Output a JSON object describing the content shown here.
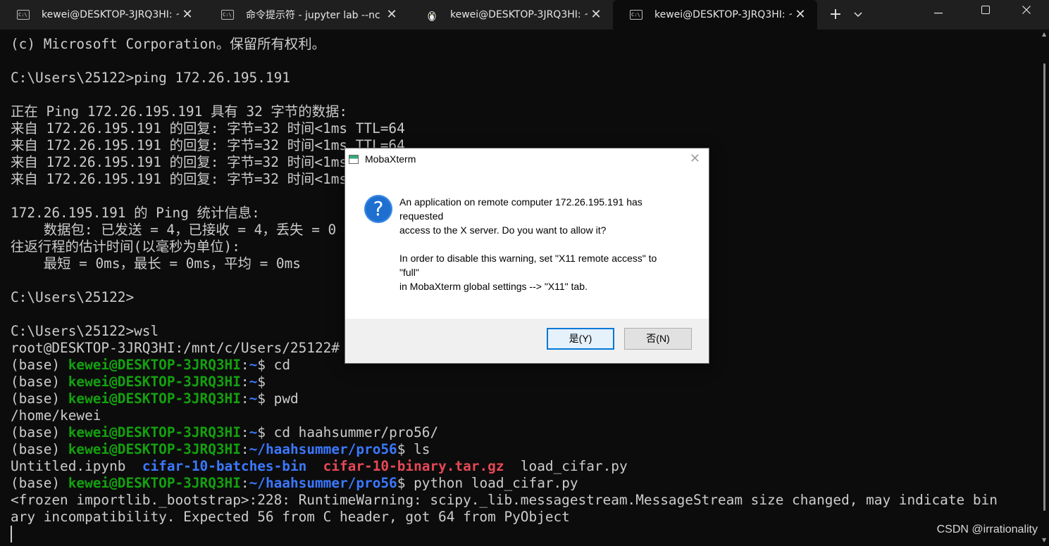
{
  "window": {
    "tabs": [
      {
        "label": "kewei@DESKTOP-3JRQ3HI: ~",
        "icon": "cmd-icon",
        "active": false
      },
      {
        "label": "命令提示符 - jupyter  lab --nc",
        "icon": "cmd-icon",
        "active": false
      },
      {
        "label": "kewei@DESKTOP-3JRQ3HI: ~",
        "icon": "tux-icon",
        "active": false
      },
      {
        "label": "kewei@DESKTOP-3JRQ3HI: ~",
        "icon": "cmd-icon",
        "active": true
      }
    ],
    "new_tab": "+",
    "dropdown": "⌄",
    "controls": {
      "minimize": "—",
      "maximize": "☐",
      "close": "✕"
    }
  },
  "terminal": {
    "lines": [
      "(c) Microsoft Corporation。保留所有权利。",
      "",
      "C:\\Users\\25122>ping 172.26.195.191",
      "",
      "正在 Ping 172.26.195.191 具有 32 字节的数据:",
      "来自 172.26.195.191 的回复: 字节=32 时间<1ms TTL=64",
      "来自 172.26.195.191 的回复: 字节=32 时间<1ms TTL=64",
      "来自 172.26.195.191 的回复: 字节=32 时间<1ms TTL=64",
      "来自 172.26.195.191 的回复: 字节=32 时间<1ms TTL=64",
      "",
      "172.26.195.191 的 Ping 统计信息:",
      "    数据包: 已发送 = 4，已接收 = 4，丢失 = 0 (0% 丢失)，",
      "往返行程的估计时间(以毫秒为单位):",
      "    最短 = 0ms，最长 = 0ms，平均 = 0ms",
      "",
      "C:\\Users\\25122>",
      "",
      "C:\\Users\\25122>wsl",
      "root@DESKTOP-3JRQ3HI:/mnt/c/Users/25122# su kewei"
    ],
    "prompt_base": "(base) ",
    "prompt_host": "kewei@DESKTOP-3JRQ3HI",
    "prompt_sep": ":",
    "prompt_dollar": "$ ",
    "home": "~",
    "proj": "~/haahsummer/pro56",
    "cmd_cd": "cd",
    "cmd_pwd": "pwd",
    "pwd_out": "/home/kewei",
    "cmd_cd_proj": "cd haahsummer/pro56/",
    "cmd_ls": "ls",
    "ls_out": {
      "f1": "Untitled.ipynb",
      "f2": "cifar-10-batches-bin",
      "f3": "cifar-10-binary.tar.gz",
      "f4": "load_cifar.py"
    },
    "cmd_python": "python load_cifar.py",
    "warn1": "<frozen importlib._bootstrap>:228: RuntimeWarning: scipy._lib.messagestream.MessageStream size changed, may indicate bin",
    "warn2": "ary incompatibility. Expected 56 from C header, got 64 from PyObject"
  },
  "colors": {
    "background": "#0c0c0c",
    "text": "#cccccc",
    "prompt_green": "#13a10e",
    "path_blue": "#3b78ff",
    "archive_red": "#e74856"
  },
  "dialog": {
    "title": "MobaXterm",
    "close": "✕",
    "icon": "question-icon",
    "message1_l1": "An application on remote computer 172.26.195.191 has",
    "message1_l2": "requested",
    "message1_l3": "access to the X server. Do you want to allow it?",
    "message2_l1": "In order to disable this warning, set \"X11 remote access\" to",
    "message2_l2": "\"full\"",
    "message2_l3": "in MobaXterm global settings --> \"X11\" tab.",
    "yes": "是(Y)",
    "no": "否(N)"
  },
  "watermark": "CSDN @irrationality"
}
